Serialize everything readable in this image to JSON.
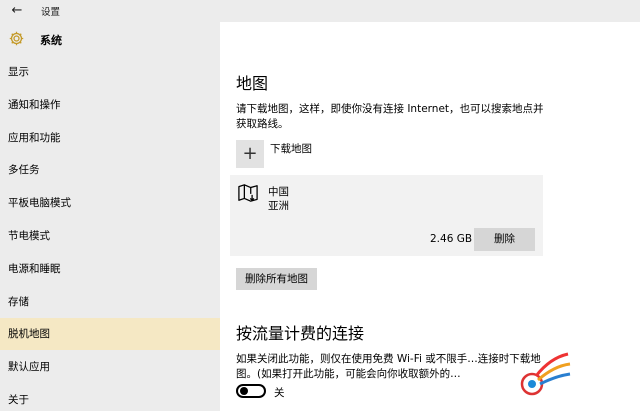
{
  "titlebar": {
    "back_icon": "back-arrow-icon",
    "title": "设置"
  },
  "sidebar": {
    "header": {
      "icon": "gear-icon",
      "label": "系统"
    },
    "items": [
      {
        "label": "显示",
        "active": false
      },
      {
        "label": "通知和操作",
        "active": false
      },
      {
        "label": "应用和功能",
        "active": false
      },
      {
        "label": "多任务",
        "active": false
      },
      {
        "label": "平板电脑模式",
        "active": false
      },
      {
        "label": "节电模式",
        "active": false
      },
      {
        "label": "电源和睡眠",
        "active": false
      },
      {
        "label": "存储",
        "active": false
      },
      {
        "label": "脱机地图",
        "active": true
      },
      {
        "label": "默认应用",
        "active": false
      },
      {
        "label": "关于",
        "active": false
      }
    ]
  },
  "maps": {
    "heading": "地图",
    "description": "请下载地图，这样，即使你没有连接 Internet，也可以搜索地点并获取路线。",
    "add_label": "下载地图",
    "card": {
      "name": "中国",
      "region": "亚洲",
      "size": "2.46 GB",
      "delete_label": "删除"
    },
    "delete_all_label": "删除所有地图"
  },
  "metered": {
    "heading": "按流量计费的连接",
    "description": "如果关闭此功能，则仅在使用免费 Wi-Fi 或不限手…连接时下载地图。(如果打开此功能，可能会向你收取额外的…",
    "toggle_state": "关"
  },
  "colors": {
    "sidebar_bg": "#ececec",
    "active_item_bg": "#f5e8c4",
    "button_bg": "#d6d6d6",
    "card_bg": "#f2f2f2"
  }
}
